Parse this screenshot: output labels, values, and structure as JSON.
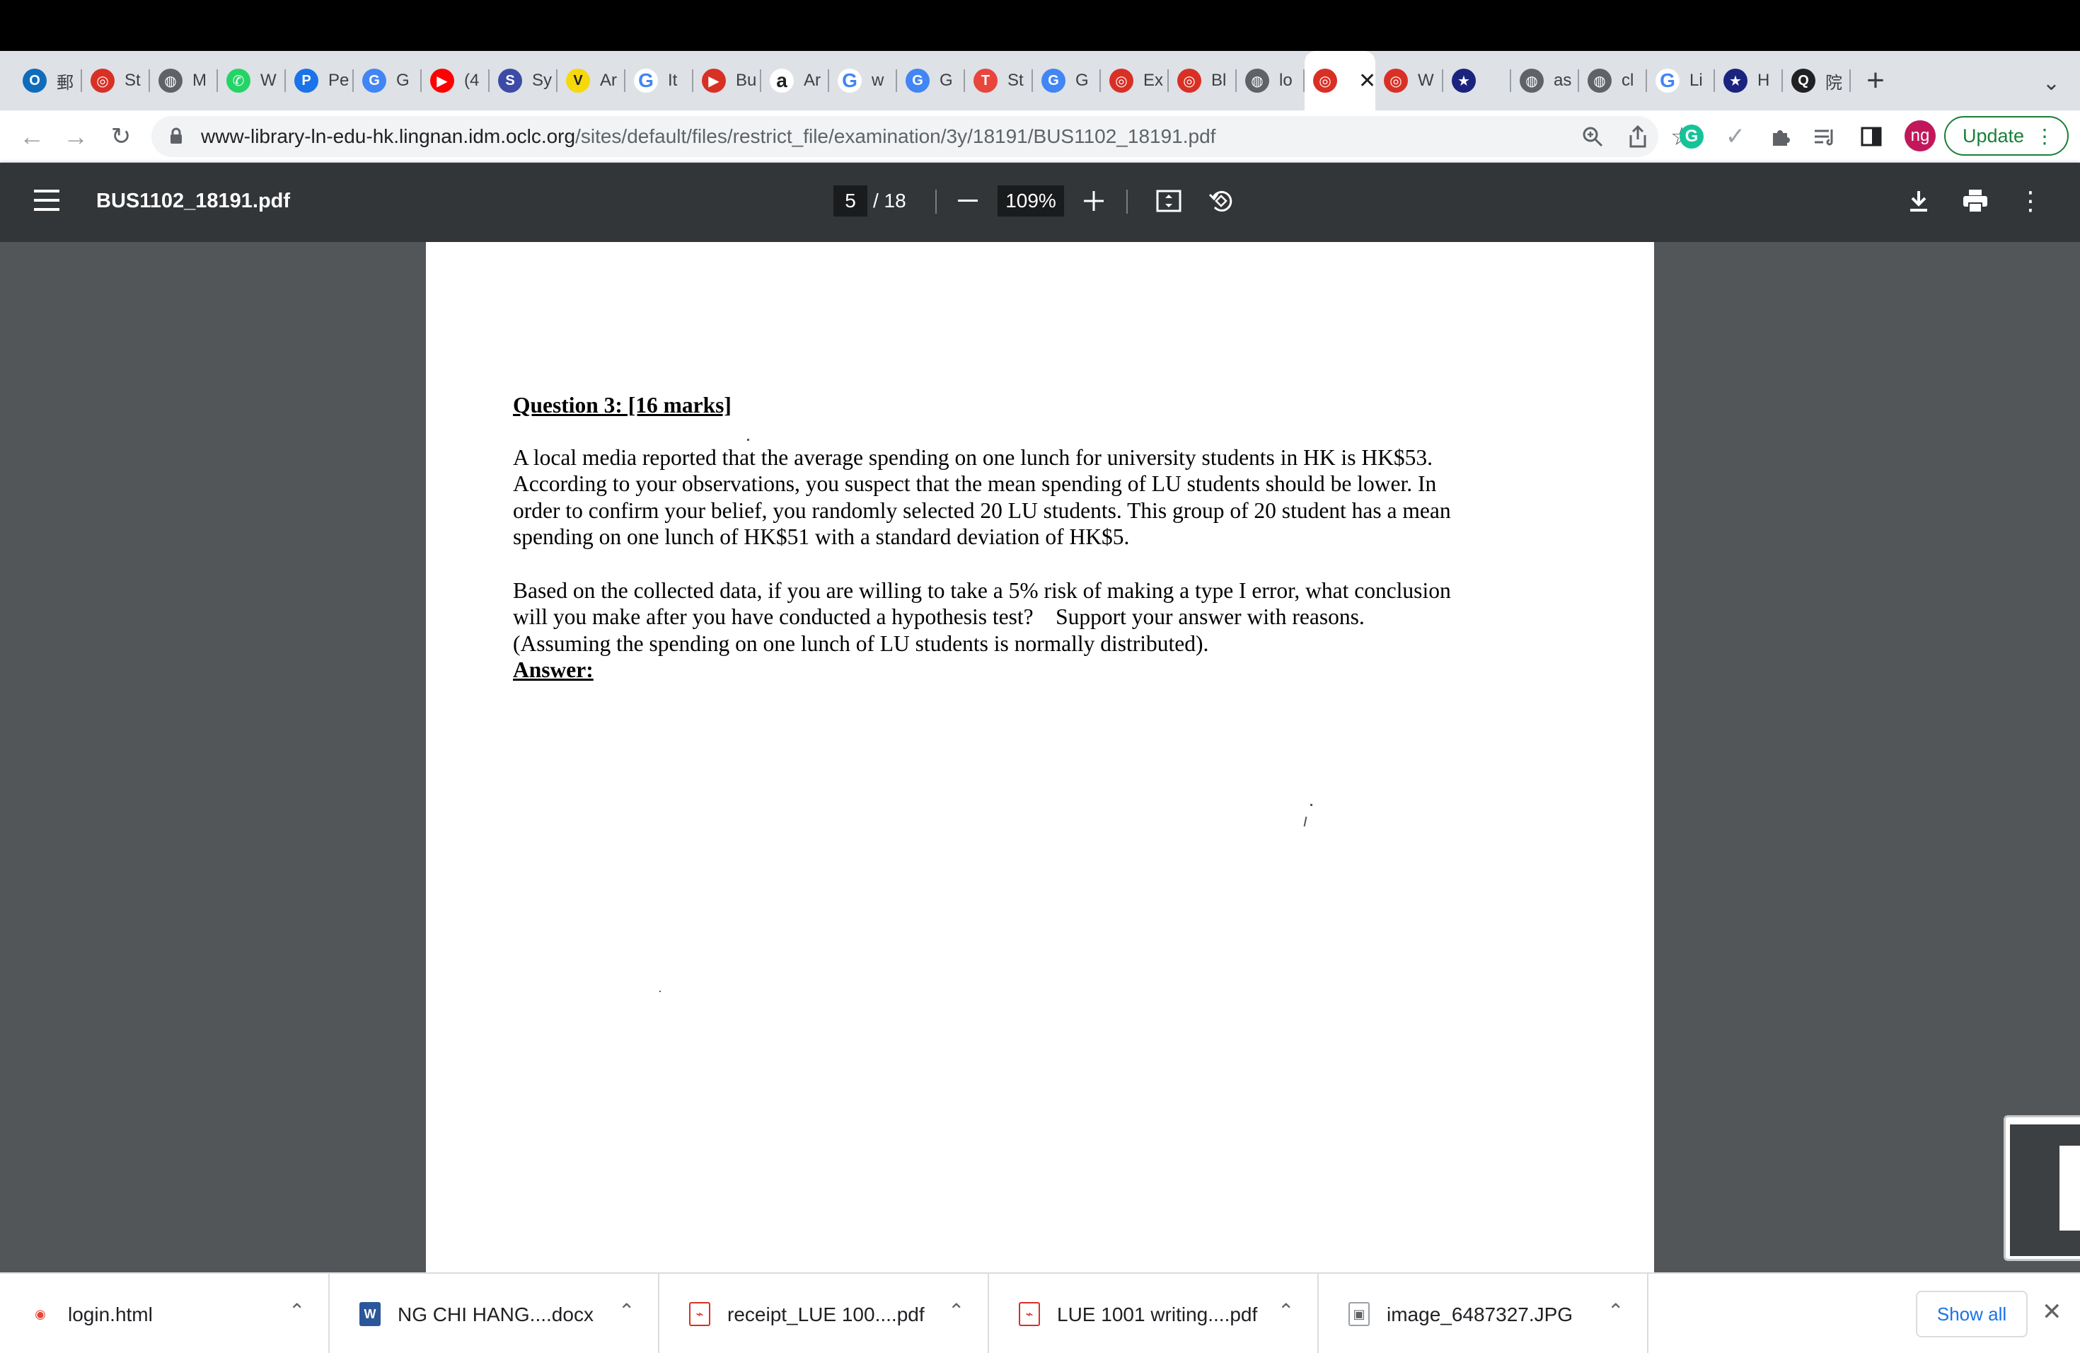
{
  "browser": {
    "tabs": [
      {
        "label": "郵",
        "icon": "outlook-icon",
        "color": "#0f6cbd"
      },
      {
        "label": "St",
        "icon": "lingnan-icon",
        "color": "#d93025"
      },
      {
        "label": "M",
        "icon": "globe-icon",
        "color": "#5f6368"
      },
      {
        "label": "W",
        "icon": "whatsapp-icon",
        "color": "#25d366"
      },
      {
        "label": "Pe",
        "icon": "p-icon",
        "color": "#1a73e8"
      },
      {
        "label": "G",
        "icon": "translate-icon",
        "color": "#4285f4"
      },
      {
        "label": "(4",
        "icon": "youtube-icon",
        "color": "#ff0000"
      },
      {
        "label": "Sy",
        "icon": "s-icon",
        "color": "#3c4ba6"
      },
      {
        "label": "Ar",
        "icon": "v-icon",
        "color": "#f5d90a"
      },
      {
        "label": "It",
        "icon": "google-icon",
        "color": "#4285f4"
      },
      {
        "label": "Bu",
        "icon": "play-icon",
        "color": "#d93025"
      },
      {
        "label": "Ar",
        "icon": "amazon-icon",
        "color": "#ffffff"
      },
      {
        "label": "w",
        "icon": "google-icon",
        "color": "#4285f4"
      },
      {
        "label": "G",
        "icon": "translate-icon",
        "color": "#4285f4"
      },
      {
        "label": "St",
        "icon": "t-icon",
        "color": "#e8453c"
      },
      {
        "label": "G",
        "icon": "translate-icon",
        "color": "#4285f4"
      },
      {
        "label": "Ex",
        "icon": "lingnan-icon",
        "color": "#d93025"
      },
      {
        "label": "Bl",
        "icon": "lingnan-icon",
        "color": "#d93025"
      },
      {
        "label": "lo",
        "icon": "globe-icon",
        "color": "#5f6368"
      },
      {
        "label": "",
        "icon": "lingnan-icon",
        "color": "#d93025",
        "active": true
      },
      {
        "label": "W",
        "icon": "lingnan-icon",
        "color": "#d93025"
      },
      {
        "label": "",
        "icon": "star-icon",
        "color": "#1a237e"
      },
      {
        "label": "as",
        "icon": "globe-icon",
        "color": "#5f6368"
      },
      {
        "label": "cl",
        "icon": "globe-icon",
        "color": "#5f6368"
      },
      {
        "label": "Li",
        "icon": "google-icon",
        "color": "#4285f4"
      },
      {
        "label": "H",
        "icon": "star-icon",
        "color": "#1a237e"
      },
      {
        "label": "院",
        "icon": "q-icon",
        "color": "#202124"
      }
    ],
    "url_host": "www-library-ln-edu-hk.lingnan.idm.oclc.org",
    "url_path": "/sites/default/files/restrict_file/examination/3y/18191/BUS1102_18191.pdf",
    "profile_initials": "ng",
    "update_label": "Update"
  },
  "pdf": {
    "filename": "BUS1102_18191.pdf",
    "current_page": "5",
    "total_pages": "/ 18",
    "zoom": "109%"
  },
  "document": {
    "question_title": "Question 3: [16 marks]",
    "paragraph1_lines": [
      "A local media reported that the average spending on one lunch for university students in HK is HK$53.",
      "According to your observations, you suspect that the mean spending of LU students should be lower. In",
      "order to confirm your belief, you randomly selected 20 LU students. This group of 20 student has a mean",
      "spending on one lunch of HK$51 with a standard deviation of HK$5."
    ],
    "paragraph2_lines": [
      "Based on the collected data, if you are willing to take a 5% risk of making a type I error, what conclusion",
      "will you make after you have conducted a hypothesis test?    Support your answer with reasons.",
      "(Assuming the spending on one lunch of LU students is normally distributed)."
    ],
    "answer_label": "Answer:"
  },
  "downloads": {
    "items": [
      {
        "name": "login.html",
        "icon": "chrome-icon"
      },
      {
        "name": "NG CHI HANG....docx",
        "icon": "word-icon"
      },
      {
        "name": "receipt_LUE 100....pdf",
        "icon": "pdf-icon"
      },
      {
        "name": "LUE 1001 writing....pdf",
        "icon": "pdf-icon"
      },
      {
        "name": "image_6487327.JPG",
        "icon": "image-icon"
      }
    ],
    "show_all_label": "Show all"
  }
}
